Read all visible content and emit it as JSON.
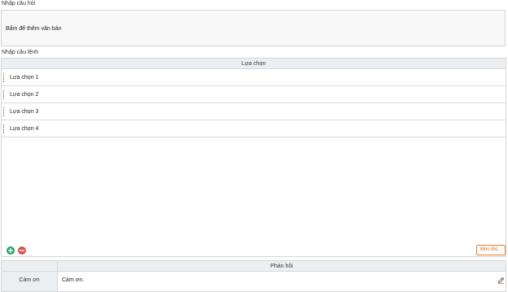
{
  "question": {
    "label": "Nhập câu hỏi",
    "placeholder": "Bấm để thêm văn bản"
  },
  "command": {
    "label": "Nhập câu lệnh"
  },
  "choices": {
    "header": "Lựa chọn",
    "items": [
      {
        "label": "Lựa chọn 1"
      },
      {
        "label": "Lựa chọn 2"
      },
      {
        "label": "Lựa chọn 3"
      },
      {
        "label": "Lựa chọn 4"
      }
    ]
  },
  "toolbar": {
    "add_icon": "plus-circle",
    "remove_icon": "minus-circle",
    "level_button": "Mức Độ..."
  },
  "response": {
    "header": "Phản hồi",
    "key": "Cảm ơn",
    "value": "Cảm ơn.",
    "edit_icon": "pencil"
  },
  "colors": {
    "add": "#25a26b",
    "remove": "#d9534f",
    "level_accent": "#e06a10",
    "header_bg": "#eceff1"
  }
}
